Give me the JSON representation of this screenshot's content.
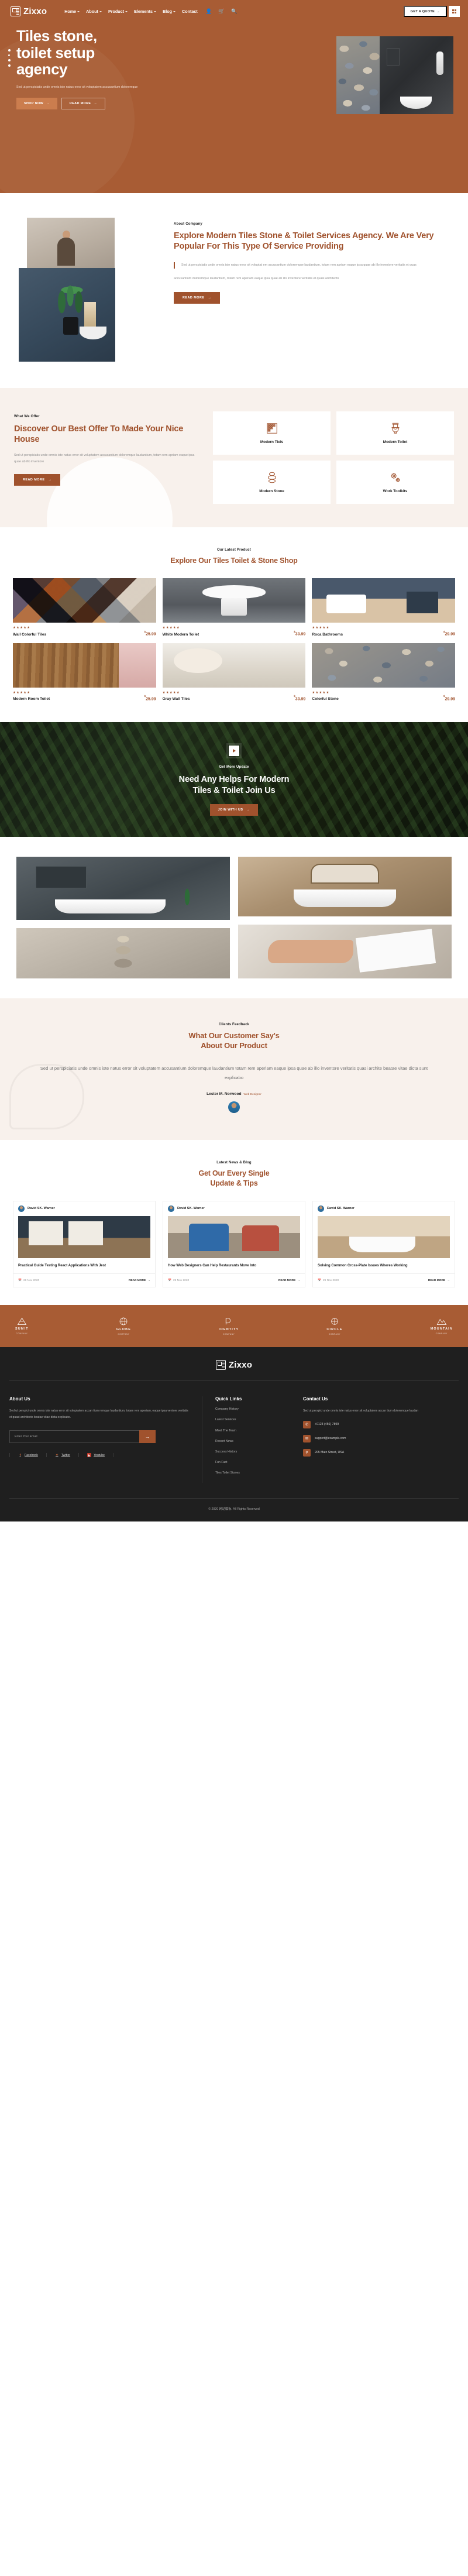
{
  "header": {
    "brand": "Zixxo",
    "nav": [
      {
        "label": "Home",
        "caret": true
      },
      {
        "label": "About",
        "caret": true
      },
      {
        "label": "Product",
        "caret": true
      },
      {
        "label": "Elements",
        "caret": true
      },
      {
        "label": "Blog",
        "caret": true
      },
      {
        "label": "Contact",
        "caret": false
      }
    ],
    "icons": [
      "user-icon",
      "cart-icon",
      "search-icon"
    ],
    "quote_label": "GET A QUOTE",
    "quote_arrow": "→"
  },
  "hero": {
    "title_lines": [
      "Tiles stone,",
      "toilet setup",
      "agency"
    ],
    "subtitle": "Sed ut perspiciatis unde omnis iste natus error sit voluptatem accusantium doloremque",
    "btn_primary": "SHOP NOW",
    "btn_secondary": "READ MORE",
    "arrow": "→"
  },
  "about": {
    "label": "About Company",
    "title": "Explore Modern Tiles Stone & Toilet Services Agency. We Are Very Popular For This Type Of Service Providing",
    "quote": "Sed ut perspiciatis unde omnis iste natus error sit voluptat em accusantium doloremque laudantium, totam rem apriam eaque ipsa quae ab illo inventore veritatis et quas",
    "paragraph": "accusantium doloremque laudantium, totam rem aperiam eaque ipsa quae ab illo inventore veritatis et quasi architecto",
    "btn": "READ MORE",
    "arrow": "→"
  },
  "offer": {
    "label": "What We Offer",
    "title": "Discover Our Best Offer To Made Your Nice House",
    "paragraph": "Sed ut perspiciatis unde omnis iste natus error sit voluptatem accusantium doloremque laudantium, totam rem apriam eaque ipsa quae ab illo inventore",
    "btn": "READ MORE",
    "arrow": "→",
    "cards": [
      {
        "icon": "tiles-icon",
        "label": "Modern Tiels"
      },
      {
        "icon": "toilet-icon",
        "label": "Modern Toilet"
      },
      {
        "icon": "stone-stack-icon",
        "label": "Modern Stone"
      },
      {
        "icon": "gears-icon",
        "label": "Work Toolkits"
      }
    ]
  },
  "products": {
    "label": "Our Latest Product",
    "title": "Explore Our Tiles Toilet & Stone Shop",
    "stars": "★★★★★",
    "currency": "$",
    "items": [
      {
        "name": "Wall Colorful Tiles",
        "price": "25.99",
        "img": "img-tiles"
      },
      {
        "name": "White Modern Toilet",
        "price": "33.99",
        "img": "img-toilet"
      },
      {
        "name": "Roca Bathrooms",
        "price": "29.99",
        "img": "img-room"
      },
      {
        "name": "Modern Room Toilet",
        "price": "25.99",
        "img": "img-wood"
      },
      {
        "name": "Gray Wall Tiles",
        "price": "33.99",
        "img": "img-gray"
      },
      {
        "name": "Colorful Stone",
        "price": "29.99",
        "img": "img-stone"
      }
    ]
  },
  "cta": {
    "play_icon": "play-icon",
    "label": "Get More Update",
    "title_lines": [
      "Need Any Helps For Modern",
      "Tiles & Toilet Join Us"
    ],
    "btn": "JOIN WITH US",
    "arrow": "→"
  },
  "testimonial": {
    "label": "Clients Feedback",
    "title_lines": [
      "What Our Customer Say's",
      "About Our Product"
    ],
    "quote": "Sed ut perspiciatis unde omnis iste natus error sit voluptatem accusantium doloremque laudantium totam rem aperiam eaque ipsa quae ab illo inventore veritatis quasi archite beatae vitae dicta sunt explicabo",
    "author": "Lester M. Norwood",
    "role": "Web Designer"
  },
  "blog": {
    "label": "Latest News & Blog",
    "title_lines": [
      "Get Our Every Single",
      "Update & Tips"
    ],
    "read_more": "READ MORE",
    "arrow": "→",
    "posts": [
      {
        "author": "David SK. Warner",
        "title": "Practical Guide Testing React Applications With Jest",
        "date": "29 Nov 2020",
        "img": "bi-1"
      },
      {
        "author": "David SK. Warner",
        "title": "How Web Designers Can Help Restaurants Move Into",
        "date": "29 Nov 2020",
        "img": "bi-2"
      },
      {
        "author": "David SK. Warner",
        "title": "Solving Common Cross-Plate Issues Wheres Working",
        "date": "29 Nov 2020",
        "img": "bi-3"
      }
    ]
  },
  "brands": [
    {
      "name": "SUMIT",
      "sub": "COMPANY",
      "icon": "mountain-icon"
    },
    {
      "name": "GLOBE",
      "sub": "COMPANY",
      "icon": "globe-icon"
    },
    {
      "name": "IDENTITY",
      "sub": "COMPANY",
      "icon": "identity-icon"
    },
    {
      "name": "CIRCLE",
      "sub": "COMPANY",
      "icon": "circle-icon"
    },
    {
      "name": "MOUNTAIN",
      "sub": "COMPANY",
      "icon": "peak-icon"
    }
  ],
  "footer": {
    "brand": "Zixxo",
    "about_title": "About Us",
    "about_text": "Sed ut perspici unde omnis iste natus error sit voluptatem accan tium remque laudantium, totam rem aperiam, eaque ipsa ventore veritatis et quasi architecto beatae vitae dicta explicabo.",
    "email_placeholder": "Enter Your Email",
    "subscribe_arrow": "→",
    "socials": [
      {
        "icon": "facebook-icon",
        "glyph": "f",
        "label": "Facebook"
      },
      {
        "icon": "twitter-icon",
        "glyph": "✦",
        "label": "Twitter"
      },
      {
        "icon": "youtube-icon",
        "glyph": "▶",
        "label": "Youtube"
      }
    ],
    "quick_title": "Quick Links",
    "quick_links": [
      "Company History",
      "Latest Services",
      "Meet The Team",
      "Recent News",
      "Success History",
      "Fun Fact",
      "Tiles Toilet Stones"
    ],
    "contact_title": "Contact Us",
    "contact_text": "Sed ut perspici unde omnis iste natus error sit voluptatem accan tium doloremque laudan",
    "contacts": [
      {
        "icon": "phone-icon",
        "glyph": "✆",
        "value": "+0123 (456) 7899"
      },
      {
        "icon": "mail-icon",
        "glyph": "✉",
        "value": "support@example.com"
      },
      {
        "icon": "location-icon",
        "glyph": "⚲",
        "value": "205 Main Street, USA"
      }
    ],
    "copyright": "© 2020 网站模板. All Rights Reserved"
  }
}
